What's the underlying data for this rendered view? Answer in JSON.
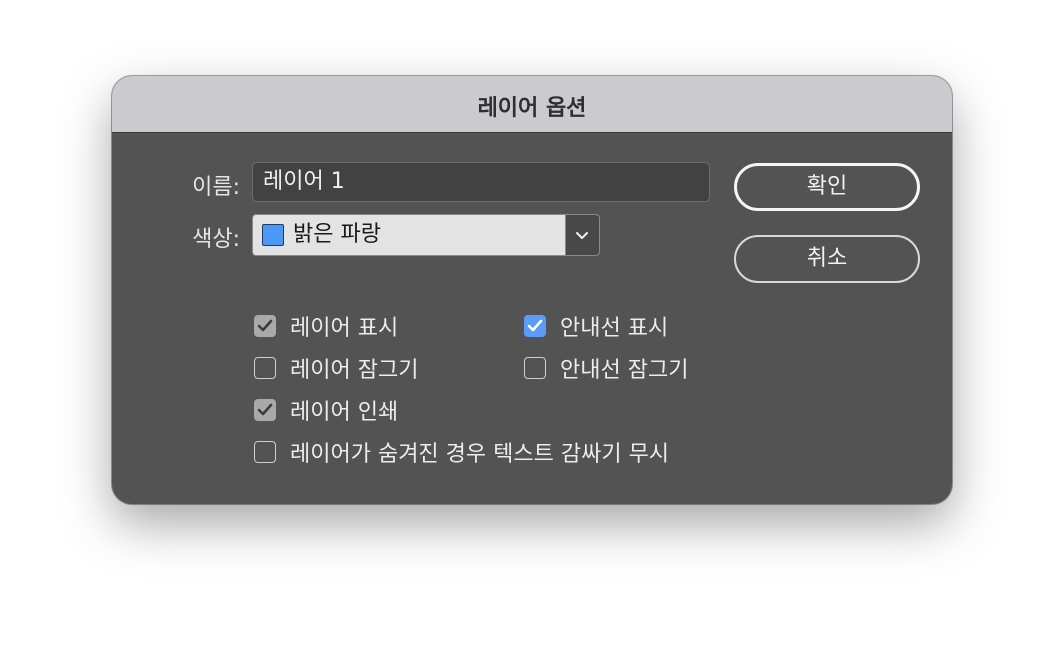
{
  "dialog": {
    "title": "레이어 옵션"
  },
  "form": {
    "name_label": "이름:",
    "name_value": "레이어 1",
    "color_label": "색상:",
    "color_value": "밝은 파랑",
    "color_swatch": "#4d98f5"
  },
  "buttons": {
    "ok_label": "확인",
    "cancel_label": "취소"
  },
  "checkboxes": [
    {
      "label": "레이어 표시",
      "checked": true,
      "style": "gray"
    },
    {
      "label": "안내선 표시",
      "checked": true,
      "style": "blue"
    },
    {
      "label": "레이어 잠그기",
      "checked": false
    },
    {
      "label": "안내선 잠그기",
      "checked": false
    },
    {
      "label": "레이어 인쇄",
      "checked": true,
      "style": "gray"
    },
    {
      "label": "레이어가 숨겨진 경우 텍스트 감싸기 무시",
      "checked": false
    }
  ],
  "icons": {
    "dropdown": "chevron-down-icon",
    "check": "checkmark-icon"
  }
}
